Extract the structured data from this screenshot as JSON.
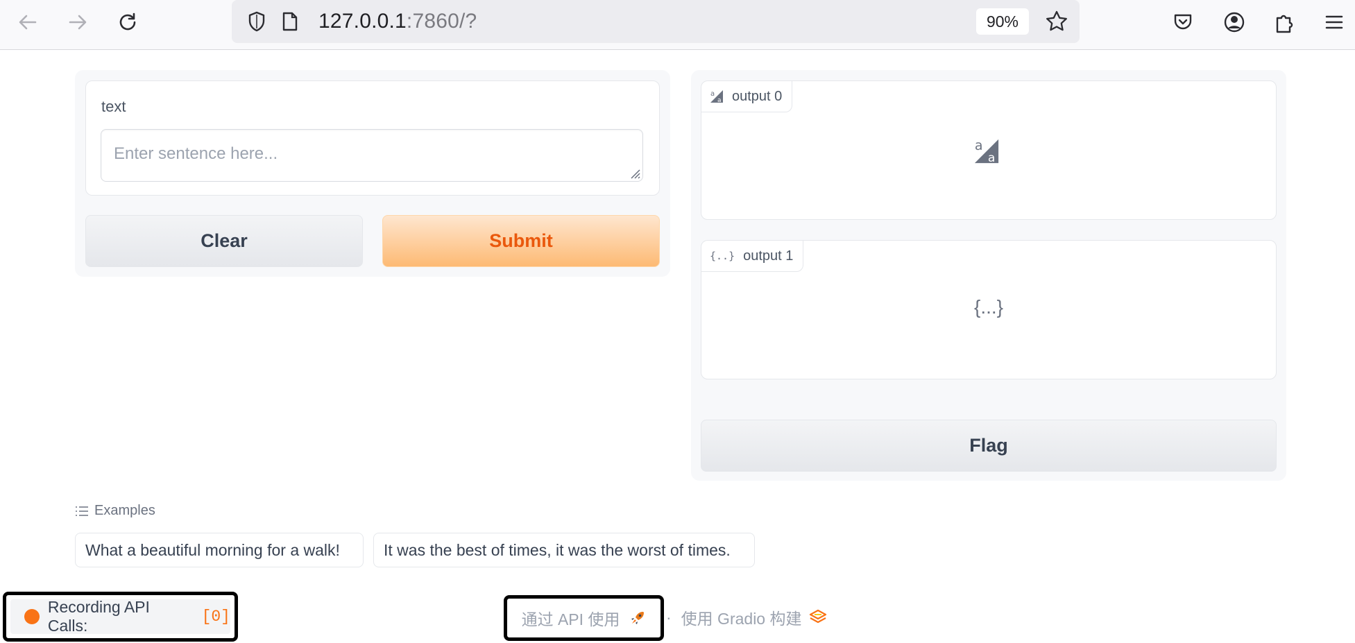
{
  "browser": {
    "url_host": "127.0.0.1",
    "url_rest": ":7860/?",
    "zoom": "90%",
    "icons": [
      "back-arrow-icon",
      "forward-arrow-icon",
      "reload-icon",
      "shield-icon",
      "page-icon",
      "star-icon",
      "pocket-icon",
      "account-icon",
      "extensions-icon",
      "menu-icon"
    ]
  },
  "input_panel": {
    "textbox_label": "text",
    "textbox_placeholder": "Enter sentence here...",
    "clear_label": "Clear",
    "submit_label": "Submit"
  },
  "output_panel": {
    "output0_label": "output 0",
    "output1_label": "output 1",
    "output1_empty_glyph": "{...}",
    "flag_label": "Flag"
  },
  "examples": {
    "label": "Examples",
    "items": [
      "What a beautiful morning for a walk!",
      "It was the best of times, it was the worst of times."
    ]
  },
  "footer": {
    "recording_label": "Recording API Calls:",
    "recording_count": "[0]",
    "api_label": "通过 API 使用",
    "separator": "·",
    "built_label": "使用 Gradio 构建"
  },
  "colors": {
    "accent": "#f97316",
    "primary_text": "#ea580c"
  }
}
